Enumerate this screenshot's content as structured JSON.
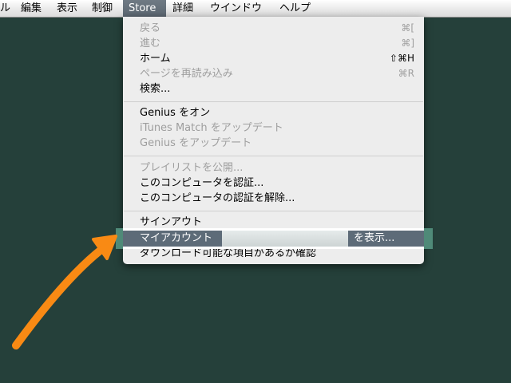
{
  "menubar": {
    "items": [
      {
        "label": "ル"
      },
      {
        "label": "編集"
      },
      {
        "label": "表示"
      },
      {
        "label": "制御"
      },
      {
        "label": "Store"
      },
      {
        "label": "詳細"
      },
      {
        "label": "ウインドウ"
      },
      {
        "label": "ヘルプ"
      }
    ]
  },
  "store_menu": {
    "back": {
      "label": "戻る",
      "shortcut": "⌘[",
      "enabled": false
    },
    "forward": {
      "label": "進む",
      "shortcut": "⌘]",
      "enabled": false
    },
    "home": {
      "label": "ホーム",
      "shortcut": "⇧⌘H",
      "enabled": true
    },
    "reload": {
      "label": "ページを再読み込み",
      "shortcut": "⌘R",
      "enabled": false
    },
    "search": {
      "label": "検索...",
      "enabled": true
    },
    "genius_on": {
      "label": "Genius をオン",
      "enabled": true
    },
    "itunes_match_update": {
      "label": "iTunes Match をアップデート",
      "enabled": false
    },
    "genius_update": {
      "label": "Genius をアップデート",
      "enabled": false
    },
    "publish_playlist": {
      "label": "プレイリストを公開...",
      "enabled": false
    },
    "authorize": {
      "label": "このコンピュータを認証...",
      "enabled": true
    },
    "deauthorize": {
      "label": "このコンピュータの認証を解除...",
      "enabled": true
    },
    "sign_out": {
      "label": "サインアウト",
      "enabled": true
    },
    "my_account": {
      "label": "マイアカウント",
      "suffix": "を表示...",
      "enabled": true,
      "highlighted": true
    },
    "check_downloads": {
      "label": "ダウンロード可能な項目があるか確認",
      "enabled": true
    }
  },
  "colors": {
    "background": "#25403a",
    "highlight_band": "#4f8a78",
    "selected_row": "#5d6b78",
    "arrow": "#f98a14"
  },
  "annotation": {
    "icon": "arrow-pointer-icon"
  }
}
